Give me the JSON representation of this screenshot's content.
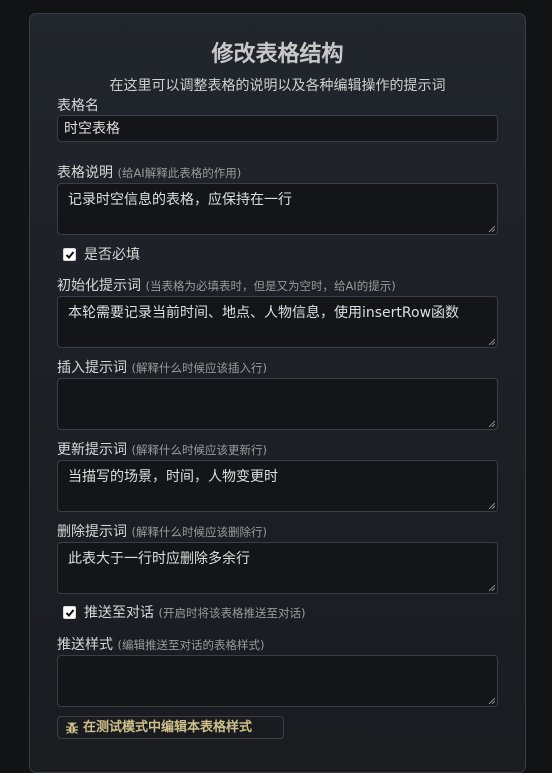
{
  "dialog": {
    "title": "修改表格结构",
    "subtitle": "在这里可以调整表格的说明以及各种编辑操作的提示词"
  },
  "table_name": {
    "label": "表格名",
    "value": "时空表格"
  },
  "table_desc": {
    "label": "表格说明",
    "hint": "(给AI解释此表格的作用)",
    "value": "记录时空信息的表格，应保持在一行"
  },
  "required": {
    "label": "是否必填",
    "checked": true
  },
  "init_prompt": {
    "label": "初始化提示词",
    "hint": "(当表格为必填表时，但是又为空时，给AI的提示)",
    "value": "本轮需要记录当前时间、地点、人物信息，使用insertRow函数"
  },
  "insert_prompt": {
    "label": "插入提示词",
    "hint": "(解释什么时候应该插入行)",
    "value": ""
  },
  "update_prompt": {
    "label": "更新提示词",
    "hint": "(解释什么时候应该更新行)",
    "value": "当描写的场景，时间，人物变更时"
  },
  "delete_prompt": {
    "label": "删除提示词",
    "hint": "(解释什么时候应该删除行)",
    "value": "此表大于一行时应删除多余行"
  },
  "push_to_chat": {
    "label": "推送至对话",
    "hint": "(开启时将该表格推送至对话)",
    "checked": true
  },
  "push_style": {
    "label": "推送样式",
    "hint": "(编辑推送至对话的表格样式)",
    "value": ""
  },
  "test_mode_button": {
    "label": "在测试模式中编辑本表格样式",
    "icon": "bug-icon"
  },
  "colors": {
    "panel_bg": "#1d2026",
    "field_bg": "#141518",
    "button_text": "#cdbf8a"
  }
}
